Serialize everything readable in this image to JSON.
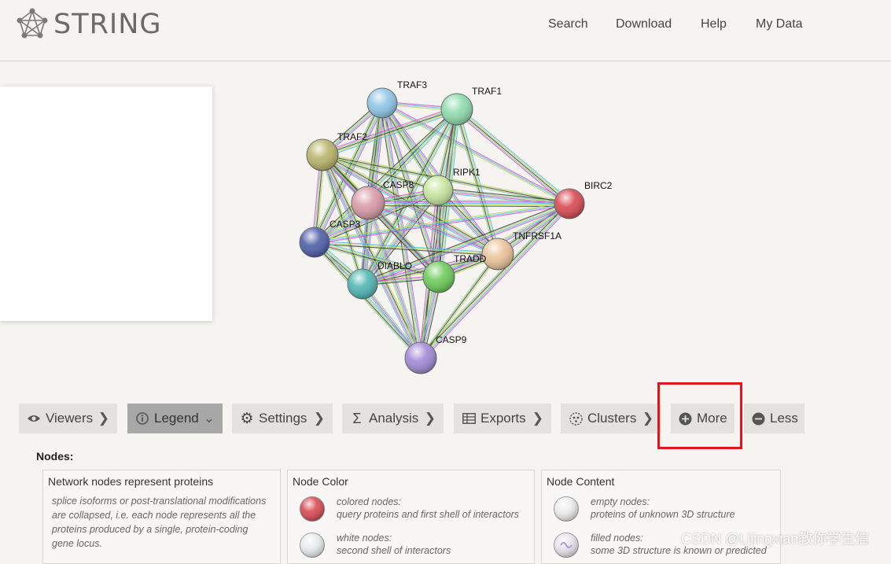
{
  "header": {
    "logo_text": "STRING",
    "nav": [
      "Search",
      "Download",
      "Help",
      "My Data"
    ]
  },
  "network": {
    "nodes": [
      {
        "name": "TRAF3",
        "color": "#8fc6e6"
      },
      {
        "name": "TRAF1",
        "color": "#8fdcae"
      },
      {
        "name": "TRAF2",
        "color": "#b9b46a"
      },
      {
        "name": "RIPK1",
        "color": "#c8e6a0"
      },
      {
        "name": "CASP8",
        "color": "#d99aa8"
      },
      {
        "name": "BIRC2",
        "color": "#d84a52"
      },
      {
        "name": "CASP3",
        "color": "#4e5fa8"
      },
      {
        "name": "TNFRSF1A",
        "color": "#ebc49a"
      },
      {
        "name": "TRADD",
        "color": "#6ccc5a"
      },
      {
        "name": "DIABLO",
        "color": "#4fb6b3"
      },
      {
        "name": "CASP9",
        "color": "#a18ad6"
      }
    ],
    "edge_colors": [
      "#d44ad4",
      "#49b8e6",
      "#b6d64a",
      "#3a3a3a",
      "#7fd07f"
    ]
  },
  "toolbar": {
    "viewers": "Viewers",
    "legend": "Legend",
    "settings": "Settings",
    "analysis": "Analysis",
    "exports": "Exports",
    "clusters": "Clusters",
    "more": "More",
    "less": "Less"
  },
  "legend": {
    "nodes_title": "Nodes:",
    "box1": {
      "title": "Network nodes represent proteins",
      "text": "splice isoforms or post-translational modifications are collapsed, i.e. each node represents all the proteins produced by a single, protein-coding gene locus."
    },
    "box2": {
      "title": "Node Color",
      "row1_line1": "colored nodes:",
      "row1_line2": "query proteins and first shell of interactors",
      "row2_line1": "white nodes:",
      "row2_line2": "second shell of interactors"
    },
    "box3": {
      "title": "Node Content",
      "row1_line1": "empty nodes:",
      "row1_line2": "proteins of unknown 3D structure",
      "row2_line1": "filled nodes:",
      "row2_line2": "some 3D structure is known or predicted"
    }
  },
  "watermark": "CSDN @Lijingxian教你学生信"
}
